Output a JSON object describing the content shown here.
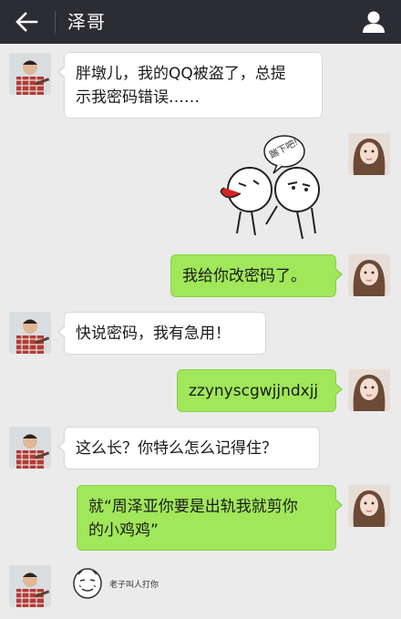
{
  "header": {
    "title": "泽哥",
    "back_icon": "arrow-left-icon",
    "profile_icon": "person-icon"
  },
  "colors": {
    "header_bg": "#2c2d32",
    "chat_bg": "#ebebeb",
    "bubble_sent": "#a0e75a",
    "bubble_received": "#ffffff"
  },
  "messages": [
    {
      "sender": "friend",
      "type": "text",
      "text_line1": "胖墩儿，我的QQ被盗了，总提",
      "text_line2": "示我密码错误……"
    },
    {
      "sender": "me",
      "type": "sticker",
      "sticker_text": "踹下吧!",
      "sticker_icon": "meme-kick-sticker-icon"
    },
    {
      "sender": "me",
      "type": "text",
      "text": "我给你改密码了。"
    },
    {
      "sender": "friend",
      "type": "text",
      "text": "快说密码，我有急用！"
    },
    {
      "sender": "me",
      "type": "text",
      "text": "zzynyscgwjjndxjj"
    },
    {
      "sender": "friend",
      "type": "text",
      "text": "这么长？你特么怎么记得住？"
    },
    {
      "sender": "me",
      "type": "text",
      "text_line1": "就“周泽亚你要是出轨我就剪你",
      "text_line2": "的小鸡鸡”"
    },
    {
      "sender": "friend",
      "type": "sticker",
      "sticker_text": "老子叫人打你",
      "sticker_icon": "meme-face-sticker-icon"
    }
  ]
}
